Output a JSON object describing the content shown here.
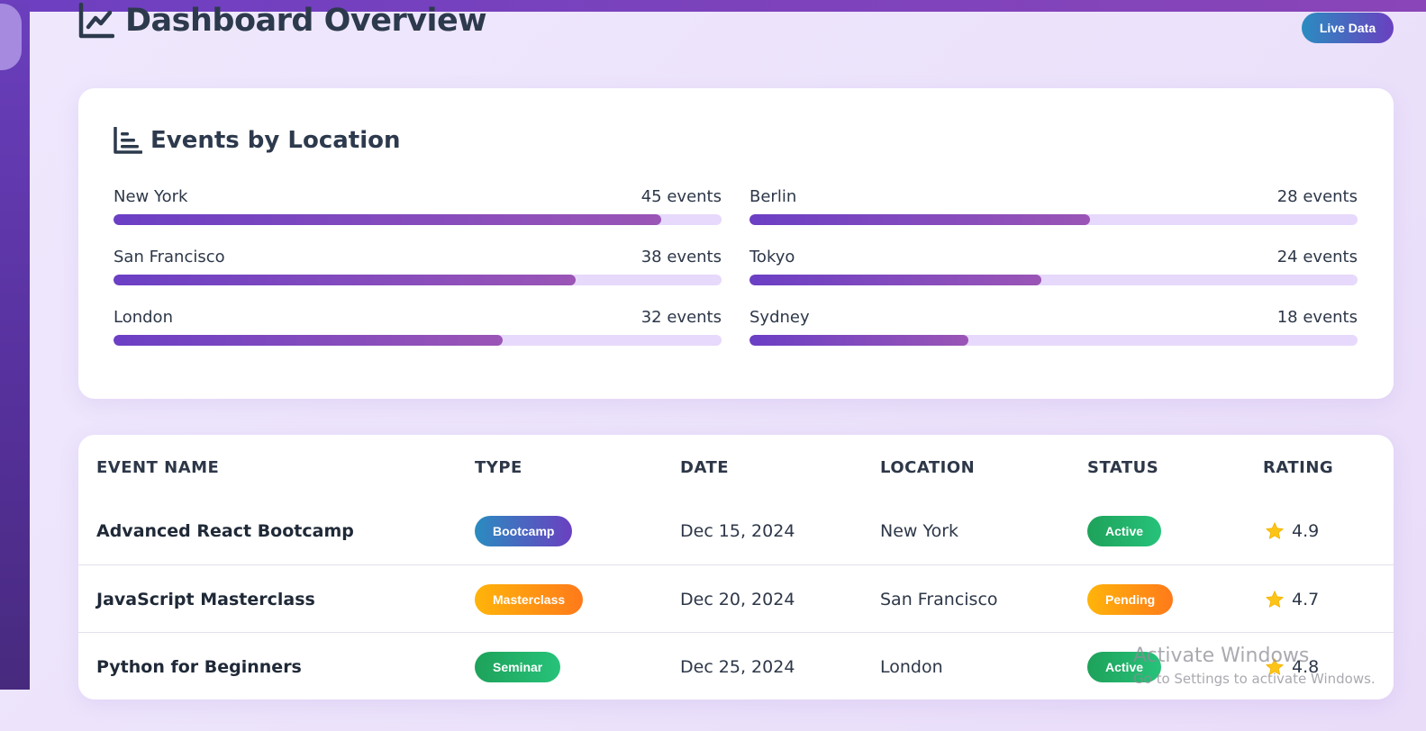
{
  "colors": {
    "accent": "#6b3fc4",
    "accent_end": "#9a55b6",
    "track": "#e6d9fb",
    "active_green": "#1ea25a",
    "pending_orange": "#ff9a10"
  },
  "header": {
    "title": "Dashboard Overview",
    "title_icon": "chart-line-icon",
    "live_badge": "Live Data"
  },
  "locations": {
    "title": "Events by Location",
    "title_icon": "bar-chart-icon",
    "max": 50,
    "items": [
      {
        "name": "New York",
        "count_label": "45 events",
        "count": 45
      },
      {
        "name": "Berlin",
        "count_label": "28 events",
        "count": 28
      },
      {
        "name": "San Francisco",
        "count_label": "38 events",
        "count": 38
      },
      {
        "name": "Tokyo",
        "count_label": "24 events",
        "count": 24
      },
      {
        "name": "London",
        "count_label": "32 events",
        "count": 32
      },
      {
        "name": "Sydney",
        "count_label": "18 events",
        "count": 18
      }
    ]
  },
  "table": {
    "headers": [
      "EVENT NAME",
      "TYPE",
      "DATE",
      "LOCATION",
      "STATUS",
      "RATING"
    ],
    "rows": [
      {
        "name": "Advanced React Bootcamp",
        "type": "Bootcamp",
        "date": "Dec 15, 2024",
        "location": "New York",
        "status": "Active",
        "rating": "4.9"
      },
      {
        "name": "JavaScript Masterclass",
        "type": "Masterclass",
        "date": "Dec 20, 2024",
        "location": "San Francisco",
        "status": "Pending",
        "rating": "4.7"
      },
      {
        "name": "Python for Beginners",
        "type": "Seminar",
        "date": "Dec 25, 2024",
        "location": "London",
        "status": "Active",
        "rating": "4.8"
      }
    ]
  },
  "watermark": {
    "line1": "Activate Windows",
    "line2": "Go to Settings to activate Windows."
  }
}
